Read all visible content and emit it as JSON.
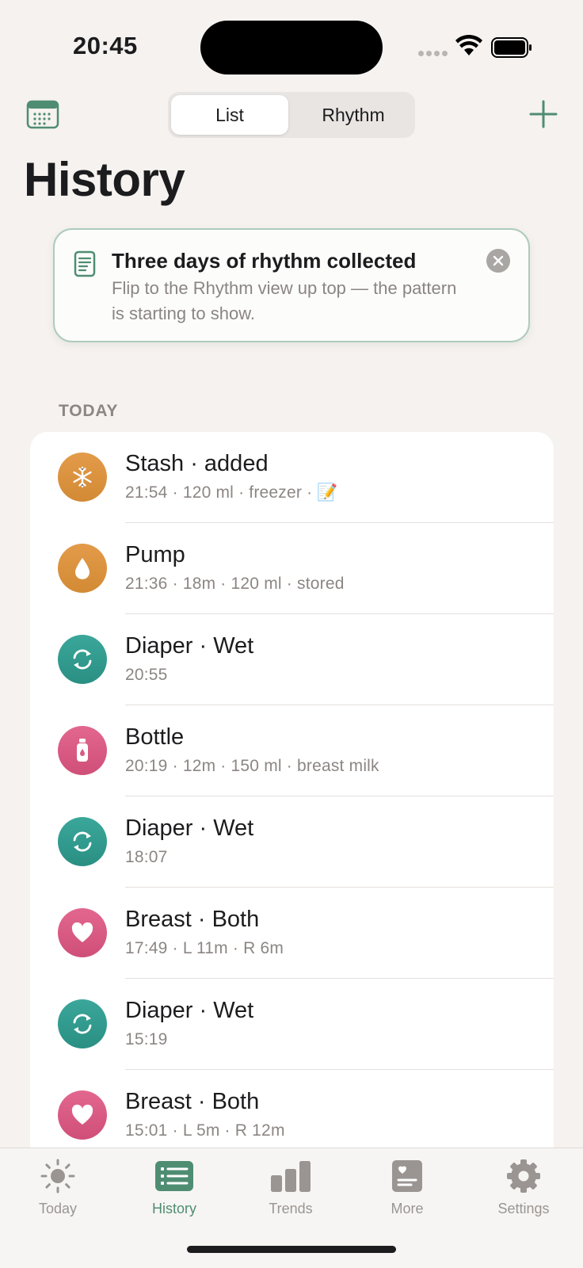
{
  "status_bar": {
    "time": "20:45"
  },
  "header": {
    "segments": [
      "List",
      "Rhythm"
    ],
    "selected_segment": "List",
    "title": "History"
  },
  "banner": {
    "title": "Three days of rhythm collected",
    "body": "Flip to the Rhythm view up top — the pattern is starting to show."
  },
  "section": {
    "label": "TODAY"
  },
  "entries": [
    {
      "title": "Stash · added",
      "subtitle": "21:54 · 120 ml · freezer · 📝",
      "icon": "snowflake-icon",
      "color": "#dd9441"
    },
    {
      "title": "Pump",
      "subtitle": "21:36 · 18m · 120 ml · stored",
      "icon": "drop-icon",
      "color": "#dd9441"
    },
    {
      "title": "Diaper · Wet",
      "subtitle": "20:55",
      "icon": "cycle-icon",
      "color": "#33998d"
    },
    {
      "title": "Bottle",
      "subtitle": "20:19 · 12m · 150 ml · breast milk",
      "icon": "bottle-icon",
      "color": "#d95b84"
    },
    {
      "title": "Diaper · Wet",
      "subtitle": "18:07",
      "icon": "cycle-icon",
      "color": "#33998d"
    },
    {
      "title": "Breast · Both",
      "subtitle": "17:49 · L 11m · R 6m",
      "icon": "heart-icon",
      "color": "#d95b84"
    },
    {
      "title": "Diaper · Wet",
      "subtitle": "15:19",
      "icon": "cycle-icon",
      "color": "#33998d"
    },
    {
      "title": "Breast · Both",
      "subtitle": "15:01 · L 5m · R 12m",
      "icon": "heart-icon",
      "color": "#d95b84"
    }
  ],
  "tabs": [
    {
      "label": "Today",
      "icon": "sun-icon"
    },
    {
      "label": "History",
      "icon": "list-icon",
      "active": true
    },
    {
      "label": "Trends",
      "icon": "bars-icon"
    },
    {
      "label": "More",
      "icon": "card-icon"
    },
    {
      "label": "Settings",
      "icon": "gear-icon"
    }
  ],
  "colors": {
    "accent": "#4f8d73",
    "orange": "#dd9441",
    "teal": "#33998d",
    "pink": "#d95b84"
  }
}
